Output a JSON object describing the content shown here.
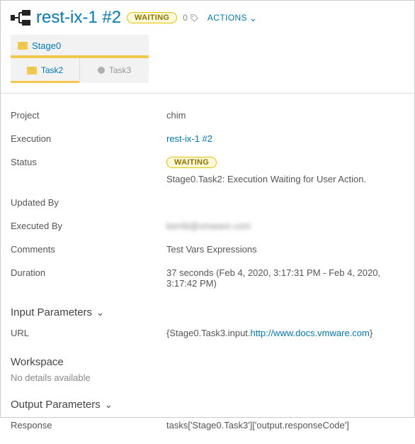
{
  "header": {
    "title": "rest-ix-1 #2",
    "status_badge": "WAITING",
    "tag_count": "0",
    "actions_label": "ACTIONS"
  },
  "stages": {
    "stage_label": "Stage0",
    "task2_label": "Task2",
    "task3_label": "Task3"
  },
  "details": {
    "project_label": "Project",
    "project_value": "chim",
    "execution_label": "Execution",
    "execution_value": "rest-ix-1 #2",
    "status_label": "Status",
    "status_badge": "WAITING",
    "status_text": "Stage0.Task2: Execution Waiting for User Action.",
    "updated_by_label": "Updated By",
    "updated_by_value": "",
    "executed_by_label": "Executed By",
    "executed_by_value": "kerrib@vmware.com",
    "comments_label": "Comments",
    "comments_value": "Test Vars Expressions",
    "duration_label": "Duration",
    "duration_value": "37 seconds (Feb 4, 2020, 3:17:31 PM - Feb 4, 2020, 3:17:42 PM)"
  },
  "input": {
    "section_label": "Input Parameters",
    "url_label": "URL",
    "url_prefix": "{Stage0.Task3.input.",
    "url_link": "http://www.docs.vmware.com",
    "url_suffix": "}"
  },
  "workspace": {
    "section_label": "Workspace",
    "empty_text": "No details available"
  },
  "output": {
    "section_label": "Output Parameters",
    "response_label": "Response",
    "response_value": "tasks['Stage0.Task3']['output.responseCode']"
  }
}
